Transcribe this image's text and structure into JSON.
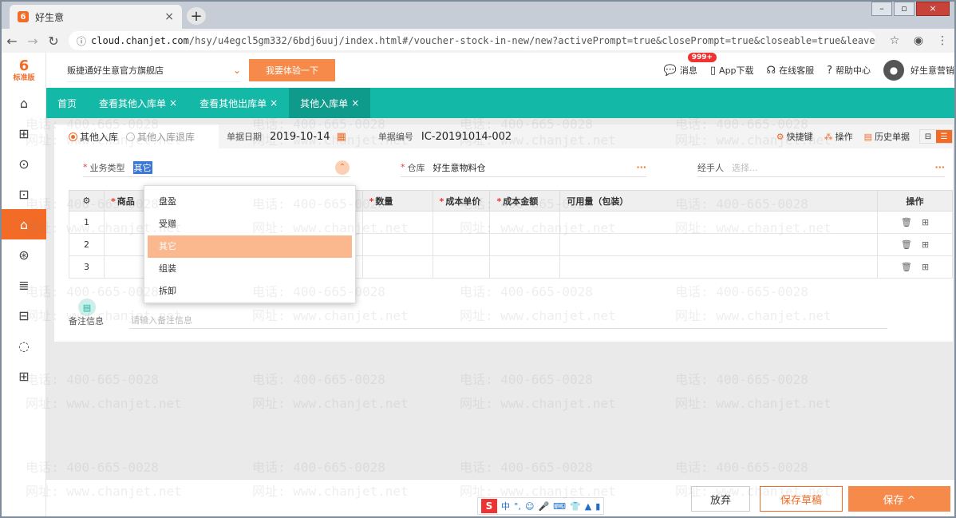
{
  "browser": {
    "tab_title": "好生意",
    "tab_close": "×",
    "new_tab": "+",
    "window_buttons": [
      "–",
      "▫",
      "×"
    ],
    "url_host": "cloud.chanjet.com",
    "url_path": "/hsy/u4egcl5gm332/6bdj6uuj/index.html#/voucher-stock-in-new/new?activePrompt=true&closePrompt=true&closeable=true&leavePrompt=L..."
  },
  "sidebar": {
    "logo_glyph": "6",
    "logo_text": "标准版",
    "items": [
      "⌂",
      "⊞",
      "⊙",
      "⊡",
      "⌂",
      "⊛",
      "≣",
      "⊟",
      "◌",
      "⊞"
    ]
  },
  "topbar": {
    "store_name": "贩捷通好生意官方旗舰店",
    "try_label": "我要体验一下",
    "messages_label": "消息",
    "messages_badge": "999+",
    "app_download": "App下载",
    "online_service": "在线客服",
    "help_center": "帮助中心",
    "user": "好生意营销"
  },
  "tabs": [
    {
      "label": "首页",
      "close": ""
    },
    {
      "label": "查看其他入库单",
      "close": "×"
    },
    {
      "label": "查看其他出库单",
      "close": "×"
    },
    {
      "label": "其他入库单",
      "close": "×"
    }
  ],
  "form": {
    "radio_in": "其他入库",
    "radio_return": "其他入库退库",
    "date_label": "单据日期",
    "date_value": "2019-10-14",
    "number_label": "单据编号",
    "number_value": "IC-20191014-002",
    "shortcut": "快捷键",
    "operations": "操作",
    "history": "历史单据",
    "view_list": "⊟",
    "view_grid": "☰",
    "biz_type_label": "业务类型",
    "biz_type_value": "其它",
    "warehouse_label": "仓库",
    "warehouse_value": "好生意物料仓",
    "handler_label": "经手人",
    "handler_placeholder": "选择..."
  },
  "table": {
    "headers": [
      "商品",
      "数量",
      "成本单价",
      "成本金额",
      "可用量（包装）",
      "操作"
    ],
    "rows": [
      "1",
      "2",
      "3"
    ]
  },
  "dropdown": {
    "options": [
      "盘盈",
      "受赠",
      "其它",
      "组装",
      "拆卸"
    ],
    "selected": "其它"
  },
  "note": {
    "label": "备注信息",
    "placeholder": "请输入备注信息"
  },
  "footer": {
    "cancel": "放弃",
    "save_draft": "保存草稿",
    "save": "保存 ^",
    "ime": [
      "S",
      "中",
      "°,",
      "☺",
      "🎤",
      "⌨",
      "👕",
      "▲",
      "▮"
    ]
  },
  "watermark": {
    "phone": "电话: 400-665-0028",
    "site": "网址: www.chanjet.net"
  }
}
